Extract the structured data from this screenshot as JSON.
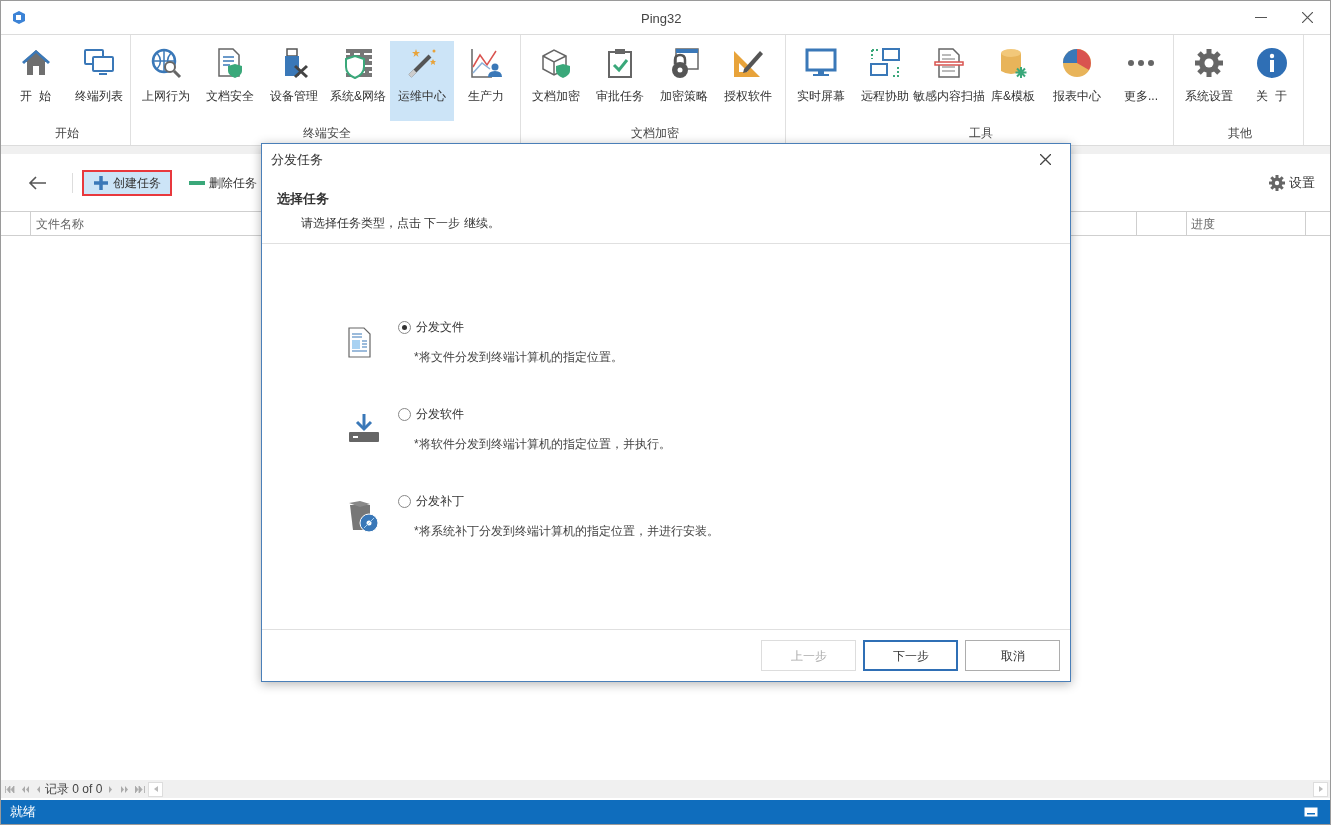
{
  "window": {
    "title": "Ping32"
  },
  "ribbon": {
    "groups": [
      {
        "label": "开始",
        "items": [
          {
            "label": "开  始",
            "selected": false
          },
          {
            "label": "终端列表",
            "selected": false
          }
        ]
      },
      {
        "label": "终端安全",
        "items": [
          {
            "label": "上网行为",
            "selected": false
          },
          {
            "label": "文档安全",
            "selected": false
          },
          {
            "label": "设备管理",
            "selected": false
          },
          {
            "label": "系统&网络",
            "selected": false
          },
          {
            "label": "运维中心",
            "selected": true
          },
          {
            "label": "生产力",
            "selected": false
          }
        ]
      },
      {
        "label": "文档加密",
        "items": [
          {
            "label": "文档加密",
            "selected": false
          },
          {
            "label": "审批任务",
            "selected": false
          },
          {
            "label": "加密策略",
            "selected": false
          },
          {
            "label": "授权软件",
            "selected": false
          }
        ]
      },
      {
        "label": "工具",
        "items": [
          {
            "label": "实时屏幕",
            "selected": false
          },
          {
            "label": "远程协助",
            "selected": false
          },
          {
            "label": "敏感内容扫描",
            "selected": false
          },
          {
            "label": "库&模板",
            "selected": false
          },
          {
            "label": "报表中心",
            "selected": false
          },
          {
            "label": "更多...",
            "selected": false
          }
        ]
      },
      {
        "label": "其他",
        "items": [
          {
            "label": "系统设置",
            "selected": false
          },
          {
            "label": "关  于",
            "selected": false
          }
        ]
      }
    ]
  },
  "toolbar": {
    "actions": [
      {
        "kind": "create",
        "label": "创建任务",
        "highlighted": true
      },
      {
        "kind": "delete",
        "label": "删除任务",
        "highlighted": false
      }
    ],
    "settings": "设置"
  },
  "table": {
    "columns": [
      "文件名称",
      "进度"
    ]
  },
  "pager": {
    "text": "记录 0 of 0"
  },
  "status_bar": {
    "text": "就绪"
  },
  "dialog": {
    "title": "分发任务",
    "heading": "选择任务",
    "subtitle": "请选择任务类型，点击 下一步 继续。",
    "options": [
      {
        "label": "分发文件",
        "description": "*将文件分发到终端计算机的指定位置。",
        "selected": true
      },
      {
        "label": "分发软件",
        "description": "*将软件分发到终端计算机的指定位置，并执行。",
        "selected": false
      },
      {
        "label": "分发补丁",
        "description": "*将系统补丁分发到终端计算机的指定位置，并进行安装。",
        "selected": false
      }
    ],
    "buttons": [
      {
        "label": "上一步",
        "disabled": true,
        "default": false
      },
      {
        "label": "下一步",
        "disabled": false,
        "default": true
      },
      {
        "label": "取消",
        "disabled": false,
        "default": false
      }
    ]
  }
}
